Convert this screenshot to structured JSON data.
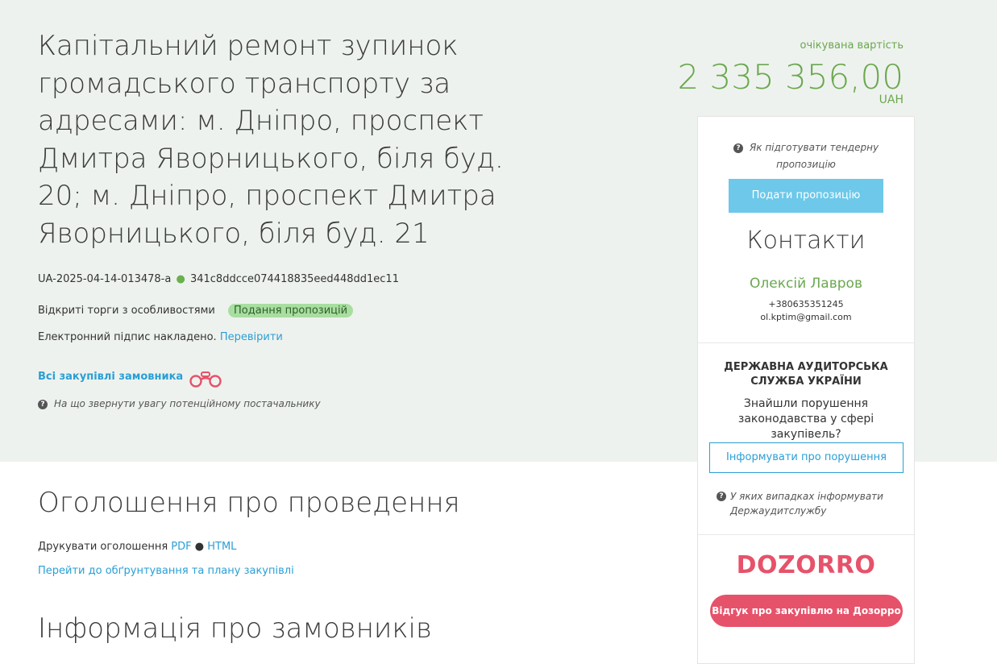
{
  "tender": {
    "title": "Капітальний ремонт зупинок громадського транспорту за адресами: м. Дніпро, проспект Дмитра Яворницького, біля буд. 20; м. Дніпро, проспект Дмитра Яворницького, біля буд. 21",
    "id": "UA-2025-04-14-013478-a",
    "hash": "341c8ddcce074418835eed448dd1ec11",
    "procedure": "Відкриті торги з особливостями",
    "status": "Подання пропозицій",
    "signature_text": "Електронний підпис накладено.",
    "signature_check": "Перевірити",
    "all_buyer_link": "Всі закупівлі замовника",
    "supplier_hint": "На що звернути увагу потенційному постачальнику"
  },
  "price": {
    "label": "очікувана вартість",
    "value": "2 335 356,00",
    "currency": "UAH"
  },
  "sidebar": {
    "how_to": "Як підготувати тендерну пропозицію",
    "submit": "Подати пропозицію",
    "contacts_title": "Контакти",
    "contact_name": "Олексій Лавров",
    "contact_phone": "+380635351245",
    "contact_email": "ol.kptim@gmail.com",
    "audit_title": "ДЕРЖАВНА АУДИТОРСЬКА СЛУЖБА УКРАЇНИ",
    "audit_question": "Знайшли порушення законодавства у сфері закупівель?",
    "inform_button": "Інформувати про порушення",
    "audit_hint": "У яких випадках інформувати Держаудитслужбу",
    "dozorro_logo": "DOZORRO",
    "dozorro_button": "Відгук про закупівлю на Дозорро"
  },
  "main": {
    "announcement_title": "Оголошення про проведення",
    "print_label": "Друкувати оголошення",
    "print_pdf": "PDF",
    "print_sep": "●",
    "print_html": "HTML",
    "plan_link": "Перейти до обґрунтування та плану закупівлі",
    "buyers_title": "Інформація про замовників"
  },
  "colors": {
    "accent_green": "#6aa84f",
    "link_blue": "#2a9fd6",
    "submit_blue": "#6dc8ea",
    "dozorro_red": "#e6526a",
    "hero_bg": "#eef2ee"
  }
}
